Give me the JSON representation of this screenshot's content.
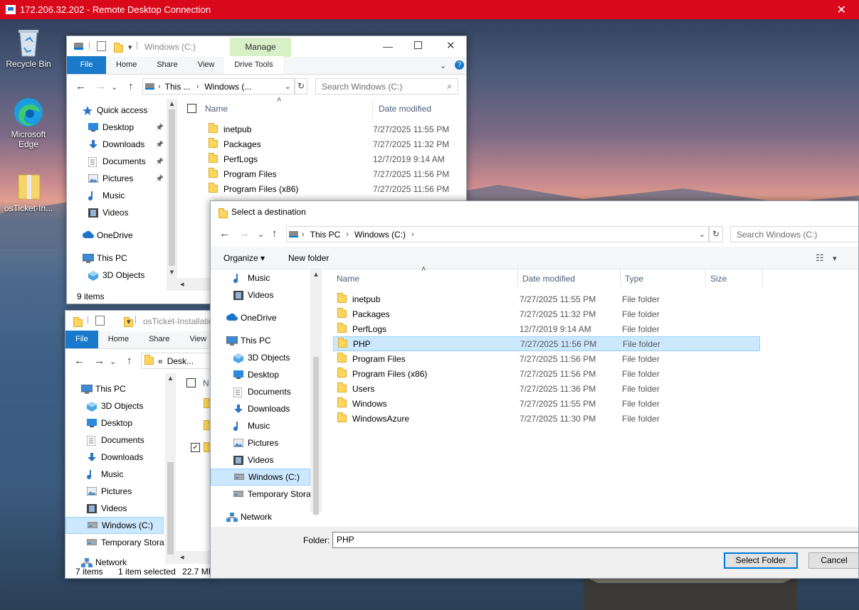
{
  "rdp": {
    "title": "172.206.32.202 - Remote Desktop Connection",
    "close": "✕"
  },
  "desktop": {
    "icons": [
      {
        "label": "Recycle Bin"
      },
      {
        "label": "Microsoft Edge"
      },
      {
        "label": "osTicket-In..."
      }
    ]
  },
  "explorer1": {
    "title": "Windows (C:)",
    "manage_tab": "Manage",
    "tabs": [
      "File",
      "Home",
      "Share",
      "View",
      "Drive Tools"
    ],
    "address": {
      "part1": "This ...",
      "part2": "Windows (..."
    },
    "search_placeholder": "Search Windows (C:)",
    "nav": [
      {
        "label": "Quick access",
        "icon": "star-icon"
      },
      {
        "label": "Desktop",
        "icon": "desktop-icon"
      },
      {
        "label": "Downloads",
        "icon": "download-icon"
      },
      {
        "label": "Documents",
        "icon": "documents-icon"
      },
      {
        "label": "Pictures",
        "icon": "pictures-icon"
      },
      {
        "label": "Music",
        "icon": "music-icon"
      },
      {
        "label": "Videos",
        "icon": "videos-icon"
      },
      {
        "label": "OneDrive",
        "icon": "cloud-icon"
      },
      {
        "label": "This PC",
        "icon": "computer-icon"
      },
      {
        "label": "3D Objects",
        "icon": "cube-icon"
      }
    ],
    "columns": [
      "Name",
      "Date modified"
    ],
    "files": [
      {
        "name": "inetpub",
        "date": "7/27/2025 11:55 PM"
      },
      {
        "name": "Packages",
        "date": "7/27/2025 11:32 PM"
      },
      {
        "name": "PerfLogs",
        "date": "12/7/2019 9:14 AM"
      },
      {
        "name": "Program Files",
        "date": "7/27/2025 11:56 PM"
      },
      {
        "name": "Program Files (x86)",
        "date": "7/27/2025 11:56 PM"
      }
    ],
    "status": "9 items"
  },
  "explorer2": {
    "title": "osTicket-Installatio",
    "tabs": [
      "File",
      "Home",
      "Share",
      "View"
    ],
    "address": {
      "prefix": "«",
      "part1": "Desk..."
    },
    "nav": [
      {
        "label": "This PC",
        "icon": "computer-icon"
      },
      {
        "label": "3D Objects",
        "icon": "cube-icon"
      },
      {
        "label": "Desktop",
        "icon": "desktop-icon"
      },
      {
        "label": "Documents",
        "icon": "documents-icon"
      },
      {
        "label": "Downloads",
        "icon": "download-icon"
      },
      {
        "label": "Music",
        "icon": "music-icon"
      },
      {
        "label": "Pictures",
        "icon": "pictures-icon"
      },
      {
        "label": "Videos",
        "icon": "videos-icon"
      },
      {
        "label": "Windows (C:)",
        "icon": "drive-icon"
      },
      {
        "label": "Temporary Stora",
        "icon": "drive-icon"
      },
      {
        "label": "Network",
        "icon": "network-icon"
      }
    ],
    "column_name": "N",
    "status": {
      "items": "7 items",
      "selected": "1 item selected",
      "size": "22.7 MB"
    }
  },
  "dialog": {
    "title": "Select a destination",
    "breadcrumb": [
      "This PC",
      "Windows (C:)"
    ],
    "search_placeholder": "Search Windows (C:)",
    "toolbar": {
      "organize": "Organize ▾",
      "new_folder": "New folder"
    },
    "nav": [
      {
        "label": "Music",
        "icon": "music-icon"
      },
      {
        "label": "Videos",
        "icon": "videos-icon"
      },
      {
        "label": "OneDrive",
        "icon": "cloud-icon"
      },
      {
        "label": "This PC",
        "icon": "computer-icon"
      },
      {
        "label": "3D Objects",
        "icon": "cube-icon"
      },
      {
        "label": "Desktop",
        "icon": "desktop-icon"
      },
      {
        "label": "Documents",
        "icon": "documents-icon"
      },
      {
        "label": "Downloads",
        "icon": "download-icon"
      },
      {
        "label": "Music",
        "icon": "music-icon"
      },
      {
        "label": "Pictures",
        "icon": "pictures-icon"
      },
      {
        "label": "Videos",
        "icon": "videos-icon"
      },
      {
        "label": "Windows (C:)",
        "icon": "drive-icon"
      },
      {
        "label": "Temporary Stora",
        "icon": "drive-icon"
      },
      {
        "label": "Network",
        "icon": "network-icon"
      }
    ],
    "columns": {
      "name": "Name",
      "date": "Date modified",
      "type": "Type",
      "size": "Size"
    },
    "files": [
      {
        "name": "inetpub",
        "date": "7/27/2025 11:55 PM",
        "type": "File folder"
      },
      {
        "name": "Packages",
        "date": "7/27/2025 11:32 PM",
        "type": "File folder"
      },
      {
        "name": "PerfLogs",
        "date": "12/7/2019 9:14 AM",
        "type": "File folder"
      },
      {
        "name": "PHP",
        "date": "7/27/2025 11:56 PM",
        "type": "File folder"
      },
      {
        "name": "Program Files",
        "date": "7/27/2025 11:56 PM",
        "type": "File folder"
      },
      {
        "name": "Program Files (x86)",
        "date": "7/27/2025 11:56 PM",
        "type": "File folder"
      },
      {
        "name": "Users",
        "date": "7/27/2025 11:36 PM",
        "type": "File folder"
      },
      {
        "name": "Windows",
        "date": "7/27/2025 11:55 PM",
        "type": "File folder"
      },
      {
        "name": "WindowsAzure",
        "date": "7/27/2025 11:30 PM",
        "type": "File folder"
      }
    ],
    "folder_label": "Folder:",
    "folder_value": "PHP",
    "select_button": "Select Folder",
    "cancel_button": "Cancel"
  }
}
